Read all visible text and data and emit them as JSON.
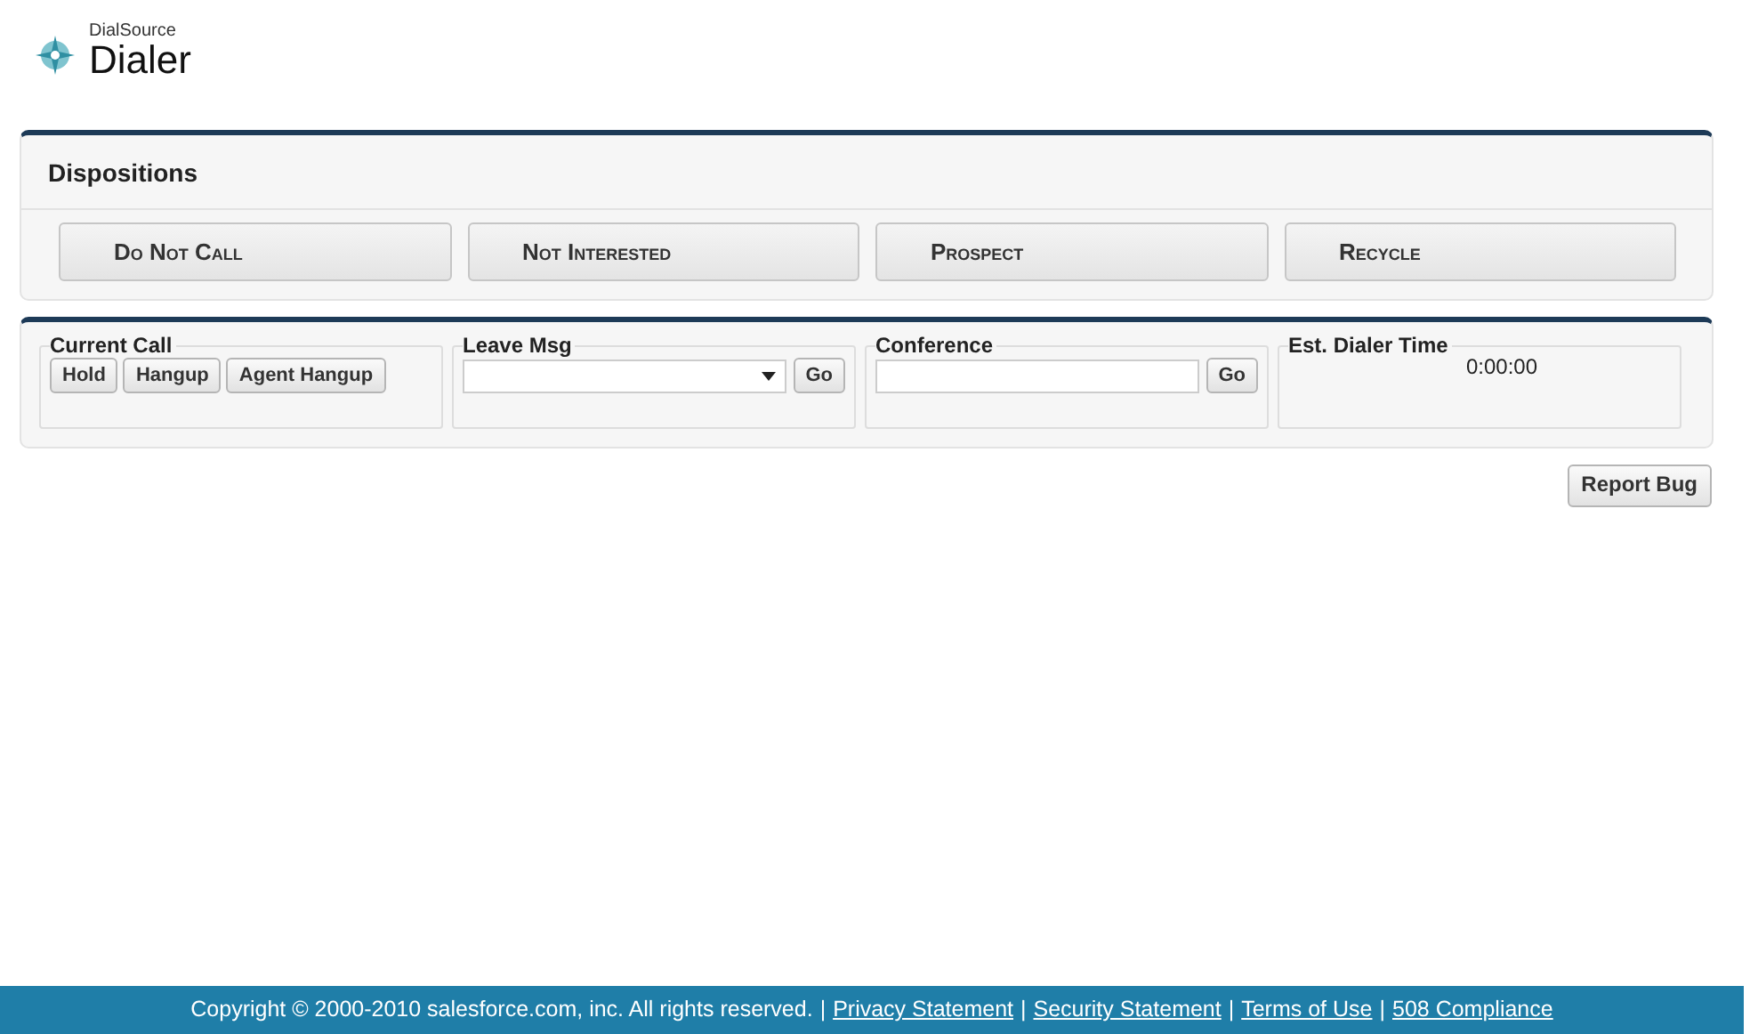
{
  "header": {
    "brand": "DialSource",
    "title": "Dialer"
  },
  "dispositions": {
    "title": "Dispositions",
    "buttons": [
      "Do Not Call",
      "Not Interested",
      "Prospect",
      "Recycle"
    ]
  },
  "call_panel": {
    "current_call": {
      "legend": "Current Call",
      "buttons": [
        "Hold",
        "Hangup",
        "Agent Hangup"
      ]
    },
    "leave_msg": {
      "legend": "Leave Msg",
      "button": "Go"
    },
    "conference": {
      "legend": "Conference",
      "button": "Go"
    },
    "dialer_time": {
      "legend": "Est. Dialer Time",
      "value": "0:00:00"
    }
  },
  "report_bug": "Report Bug",
  "footer": {
    "separator": "|",
    "items": [
      {
        "kind": "text",
        "label": "Copyright © 2000-2010 salesforce.com, inc. All rights reserved."
      },
      {
        "kind": "link",
        "label": "Privacy Statement"
      },
      {
        "kind": "link",
        "label": "Security Statement"
      },
      {
        "kind": "link",
        "label": "Terms of Use"
      },
      {
        "kind": "link",
        "label": "508 Compliance"
      }
    ]
  }
}
